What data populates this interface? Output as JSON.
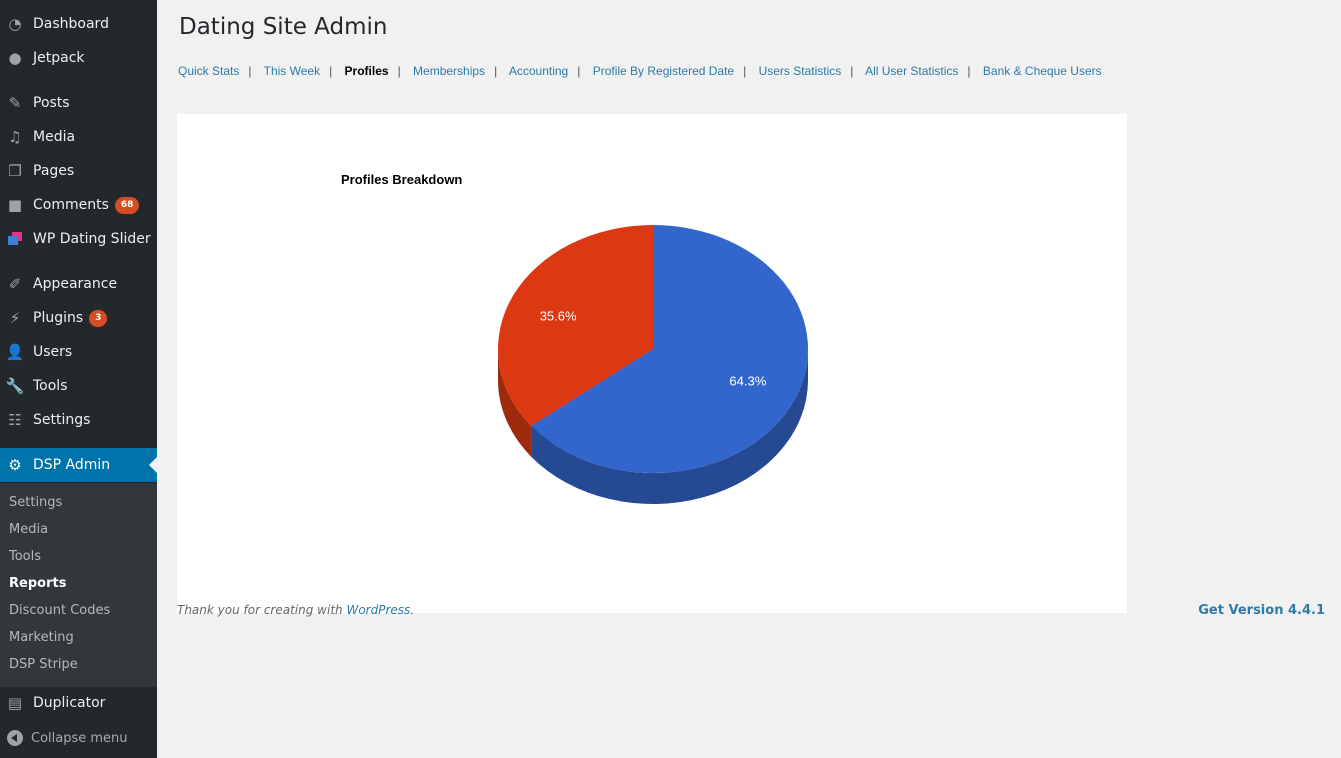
{
  "sidebar": {
    "items": [
      {
        "label": "Dashboard",
        "icon": "dashboard-icon"
      },
      {
        "label": "Jetpack",
        "icon": "jetpack-icon"
      },
      {
        "label": "Posts",
        "icon": "pin-icon"
      },
      {
        "label": "Media",
        "icon": "media-icon"
      },
      {
        "label": "Pages",
        "icon": "pages-icon"
      },
      {
        "label": "Comments",
        "icon": "comment-icon",
        "badge": "68"
      },
      {
        "label": "WP Dating Slider",
        "icon": "slider-icon"
      },
      {
        "label": "Appearance",
        "icon": "brush-icon"
      },
      {
        "label": "Plugins",
        "icon": "plug-icon",
        "badge": "3"
      },
      {
        "label": "Users",
        "icon": "user-icon"
      },
      {
        "label": "Tools",
        "icon": "wrench-icon"
      },
      {
        "label": "Settings",
        "icon": "sliders-icon"
      },
      {
        "label": "DSP Admin",
        "icon": "gear-icon",
        "active": true
      },
      {
        "label": "Duplicator",
        "icon": "duplicator-icon"
      }
    ],
    "submenu": [
      "Settings",
      "Media",
      "Tools",
      "Reports",
      "Discount Codes",
      "Marketing",
      "DSP Stripe"
    ],
    "submenu_current": "Reports",
    "collapse_label": "Collapse menu"
  },
  "header": {
    "title": "Dating Site Admin"
  },
  "subnav": {
    "items": [
      "Quick Stats",
      "This Week",
      "Profiles",
      "Memberships",
      "Accounting",
      "Profile By Registered Date",
      "Users Statistics",
      "All User Statistics",
      "Bank & Cheque Users"
    ],
    "current": "Profiles",
    "separator": "|"
  },
  "chart_data": {
    "type": "pie",
    "title": "Profiles Breakdown",
    "three_d": true,
    "legend": "none",
    "slices": [
      {
        "label": "64.3%",
        "value": 64.3,
        "color": "#3366cc"
      },
      {
        "label": "35.6%",
        "value": 35.6,
        "color": "#dc3912"
      }
    ]
  },
  "footer": {
    "thanks_prefix": "Thank you for creating with ",
    "thanks_link": "WordPress",
    "thanks_suffix": ".",
    "version": "Get Version 4.4.1"
  },
  "colors": {
    "sidebar_bg": "#23282d",
    "active": "#0073aa",
    "link": "#2e7aa9",
    "badge": "#d54e21"
  }
}
